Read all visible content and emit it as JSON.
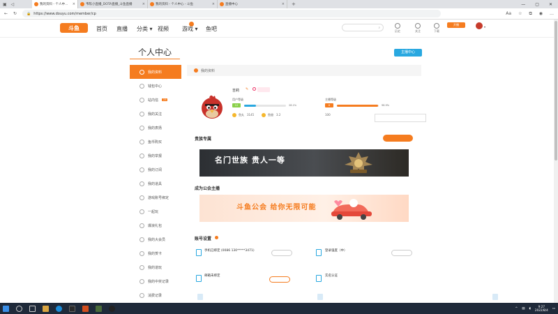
{
  "browser": {
    "tabs": [
      {
        "title": "我的资料 - 个人中心 - 斗鱼",
        "active": true
      },
      {
        "title": "韦陈小直播_DOTA直播_斗鱼直播",
        "active": false
      },
      {
        "title": "我的资料 - 个人中心 - 斗鱼",
        "active": false
      },
      {
        "title": "直播中心",
        "active": false
      }
    ],
    "url": "https://www.douyu.com/member/cp"
  },
  "topnav": {
    "logo_text": "斗鱼",
    "items": [
      {
        "label": "首页"
      },
      {
        "label": "直播"
      },
      {
        "label": "分类 ▾"
      },
      {
        "label": "视频"
      },
      {
        "label": "游戏 ▾"
      },
      {
        "label": "鱼吧"
      }
    ],
    "search_placeholder": "",
    "right_icons": [
      {
        "label": "历史"
      },
      {
        "label": "关注"
      },
      {
        "label": "下载"
      }
    ],
    "cta_label": "开播"
  },
  "page": {
    "title": "个人中心",
    "anchor_chip": "主播中心"
  },
  "sidebar": {
    "items": [
      {
        "label": "我的资料",
        "active": true
      },
      {
        "label": "钱包中心"
      },
      {
        "label": "站内信",
        "badge": "23"
      },
      {
        "label": "我的关注"
      },
      {
        "label": "我的表扬"
      },
      {
        "label": "鱼币购买"
      },
      {
        "label": "我的举报"
      },
      {
        "label": "我的订阅"
      },
      {
        "label": "我的道具"
      },
      {
        "label": "游戏账号绑定"
      },
      {
        "label": "一起玩"
      },
      {
        "label": "爆浪礼包"
      },
      {
        "label": "我的大会员"
      },
      {
        "label": "我的贺卡"
      },
      {
        "label": "我的道玩"
      },
      {
        "label": "我的中奖记录"
      },
      {
        "label": "消费记录"
      }
    ]
  },
  "content": {
    "header": "我的资料",
    "profile": {
      "nickname": "吉莉",
      "tag": "",
      "user_level_label": "用户等级",
      "user_level": "12",
      "user_pct": "28.1%",
      "user_pct_value": 28.1,
      "user_link": "",
      "anchor_level_label": "主播等级",
      "anchor_level": "6",
      "anchor_pct": "98.9%",
      "anchor_pct_value": 98.9,
      "anchor_link": "",
      "stats": [
        {
          "label": "鱼丸",
          "value": "3145"
        },
        {
          "label": "鱼翅",
          "value": "3.2"
        }
      ],
      "extra_label": "",
      "extra_value": "100",
      "tooltip": ""
    },
    "sec_noble": {
      "title": "贵族专属",
      "desc": "",
      "button": "",
      "banner_title": "名门世族 贵人一等",
      "banner_sub": ""
    },
    "sec_guild": {
      "title": "成为公会主播",
      "desc": "",
      "banner_title": "斗鱼公会 给你无限可能",
      "banner_sub": ""
    },
    "sec_account": {
      "title": "账号设置",
      "desc": "",
      "rows": [
        {
          "title": "手机已绑定 (0086 130*****3471)",
          "sub": "",
          "btn": ""
        },
        {
          "title": "登录强度（中）",
          "sub": "",
          "btn": ""
        },
        {
          "title": "邮箱未绑定",
          "sub": "",
          "btn": ""
        },
        {
          "title": "实名认证",
          "sub": "",
          "btn": ""
        }
      ]
    }
  },
  "taskbar": {
    "time": "9:27",
    "date": "2022/8/4"
  },
  "colors": {
    "brand": "#f57c1f",
    "link": "#29a8e0"
  }
}
